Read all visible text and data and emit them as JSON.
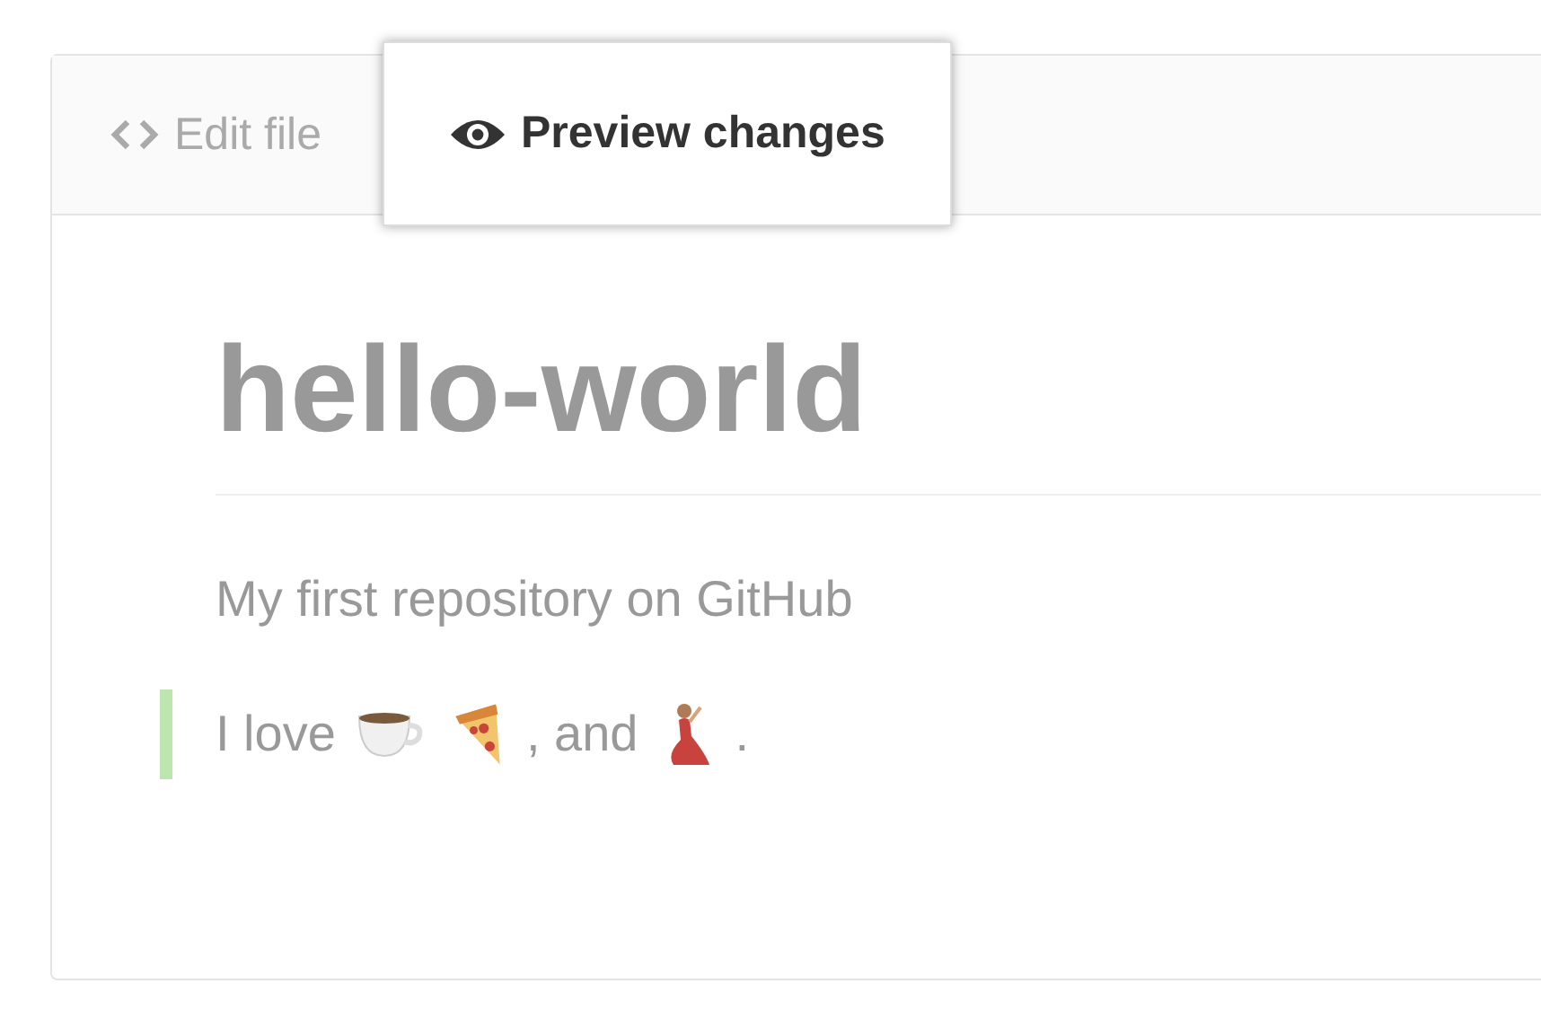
{
  "tabs": [
    {
      "label": "Edit file",
      "kind": "code",
      "selected": false
    },
    {
      "label": "Preview changes",
      "kind": "eye",
      "selected": true
    }
  ],
  "heading": "hello-world",
  "description": "My first repository on GitHub",
  "quote": [
    {
      "kind": "text",
      "text": "I love"
    },
    {
      "kind": "cup"
    },
    {
      "kind": "pizza"
    },
    {
      "kind": "text",
      "text": ", and"
    },
    {
      "kind": "dancer"
    },
    {
      "kind": "text",
      "text": "."
    }
  ]
}
